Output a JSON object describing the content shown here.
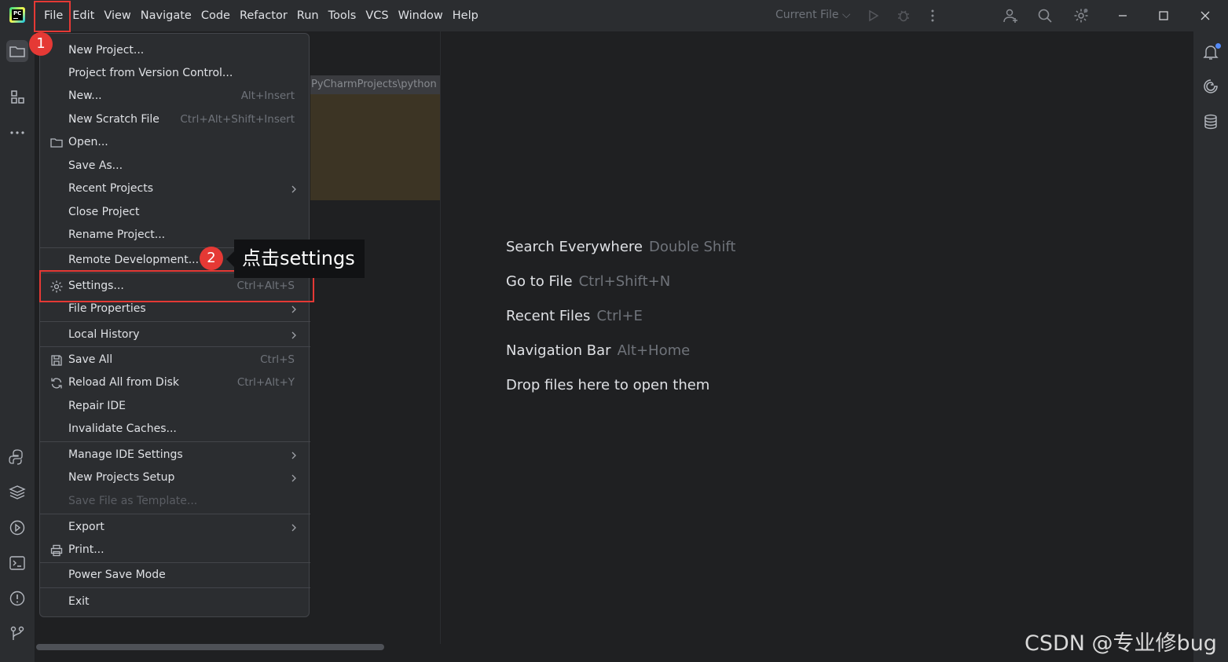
{
  "titlebar": {
    "menu": [
      "File",
      "Edit",
      "View",
      "Navigate",
      "Code",
      "Refactor",
      "Run",
      "Tools",
      "VCS",
      "Window",
      "Help"
    ],
    "current_file": "Current File ⌵",
    "icons": [
      "run-icon",
      "debug-icon",
      "more-vertical-icon",
      "add-user-icon",
      "search-icon",
      "settings-gear-icon"
    ],
    "window_controls": [
      "minimize-icon",
      "maximize-icon",
      "close-icon"
    ]
  },
  "left_toolbar": [
    "folder-icon",
    "structure-icon",
    "more-horizontal-icon",
    "python-console-icon",
    "layers-icon",
    "services-icon",
    "terminal-icon",
    "problems-icon",
    "git-branch-icon"
  ],
  "right_toolbar": [
    "notifications-icon",
    "ai-assistant-icon",
    "database-icon"
  ],
  "project_panel": {
    "path_fragment": "PyCharmProjects\\python"
  },
  "file_menu": {
    "items": [
      {
        "label": "New Project...",
        "shortcut": ""
      },
      {
        "label": "Project from Version Control...",
        "shortcut": ""
      },
      {
        "label": "New...",
        "shortcut": "Alt+Insert"
      },
      {
        "label": "New Scratch File",
        "shortcut": "Ctrl+Alt+Shift+Insert"
      },
      {
        "label": "Open...",
        "shortcut": "",
        "icon": "folder-icon"
      },
      {
        "label": "Save As...",
        "shortcut": ""
      },
      {
        "label": "Recent Projects",
        "shortcut": "",
        "submenu": true
      },
      {
        "label": "Close Project",
        "shortcut": ""
      },
      {
        "label": "Rename Project...",
        "shortcut": ""
      },
      {
        "label": "Remote Development...",
        "shortcut": ""
      },
      {
        "label": "Settings...",
        "shortcut": "Ctrl+Alt+S",
        "icon": "settings-gear-icon"
      },
      {
        "label": "File Properties",
        "shortcut": "",
        "submenu": true
      },
      {
        "label": "Local History",
        "shortcut": "",
        "submenu": true
      },
      {
        "label": "Save All",
        "shortcut": "Ctrl+S",
        "icon": "save-icon"
      },
      {
        "label": "Reload All from Disk",
        "shortcut": "Ctrl+Alt+Y",
        "icon": "reload-icon"
      },
      {
        "label": "Repair IDE",
        "shortcut": ""
      },
      {
        "label": "Invalidate Caches...",
        "shortcut": ""
      },
      {
        "label": "Manage IDE Settings",
        "shortcut": "",
        "submenu": true
      },
      {
        "label": "New Projects Setup",
        "shortcut": "",
        "submenu": true
      },
      {
        "label": "Save File as Template...",
        "shortcut": "",
        "disabled": true
      },
      {
        "label": "Export",
        "shortcut": "",
        "submenu": true
      },
      {
        "label": "Print...",
        "shortcut": "",
        "icon": "print-icon"
      },
      {
        "label": "Power Save Mode",
        "shortcut": ""
      },
      {
        "label": "Exit",
        "shortcut": ""
      }
    ]
  },
  "welcome_hints": [
    {
      "label": "Search Everywhere",
      "shortcut": "Double Shift"
    },
    {
      "label": "Go to File",
      "shortcut": "Ctrl+Shift+N"
    },
    {
      "label": "Recent Files",
      "shortcut": "Ctrl+E"
    },
    {
      "label": "Navigation Bar",
      "shortcut": "Alt+Home"
    },
    {
      "label": "Drop files here to open them",
      "shortcut": ""
    }
  ],
  "annotations": {
    "step1": "1",
    "step2": "2",
    "tooltip": "点击settings",
    "accent_color": "#e53935"
  },
  "watermark": "CSDN @专业修bug"
}
